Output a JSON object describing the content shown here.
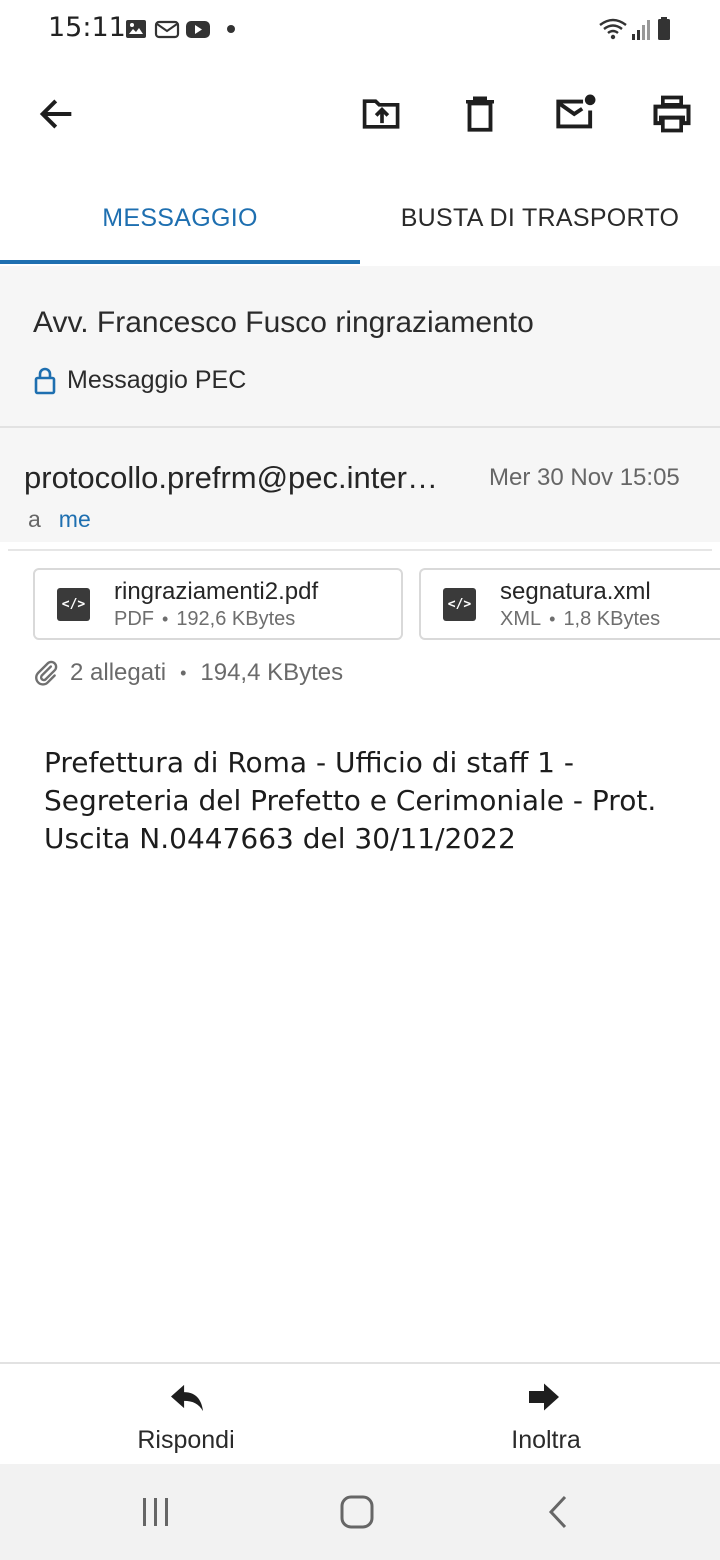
{
  "status_bar": {
    "time": "15:11",
    "notification_icons": [
      "gallery-icon",
      "email-icon",
      "youtube-icon",
      "dot-icon"
    ],
    "system_icons": [
      "wifi-icon",
      "signal-icon",
      "battery-icon"
    ]
  },
  "toolbar": {
    "back_icon": "arrow-left-icon",
    "actions": [
      "folder-move-icon",
      "trash-icon",
      "mark-unread-icon",
      "print-icon"
    ]
  },
  "tabs": [
    {
      "label": "MESSAGGIO",
      "active": true
    },
    {
      "label": "BUSTA DI TRASPORTO",
      "active": false
    }
  ],
  "message": {
    "subject": "Avv. Francesco Fusco ringraziamento",
    "type_label": "Messaggio PEC",
    "sender": "protocollo.prefrm@pec.inter…",
    "date": "Mer 30 Nov 15:05",
    "to_label": "a",
    "to_value": "me"
  },
  "attachments": {
    "items": [
      {
        "name": "ringraziamenti2.pdf",
        "type": "PDF",
        "size": "192,6 KBytes"
      },
      {
        "name": "segnatura.xml",
        "type": "XML",
        "size": "1,8 KBytes"
      }
    ],
    "separator": "•",
    "summary_count": "2 allegati",
    "summary_size": "194,4 KBytes"
  },
  "body": {
    "text": "Prefettura di Roma - Ufficio di staff 1 - Segreteria del Prefetto e Cerimoniale - Prot. Uscita N.0447663 del 30/11/2022"
  },
  "actions": {
    "reply_label": "Rispondi",
    "forward_label": "Inoltra"
  },
  "colors": {
    "accent": "#1e6fb0",
    "header_bg": "#f6f6f6"
  }
}
